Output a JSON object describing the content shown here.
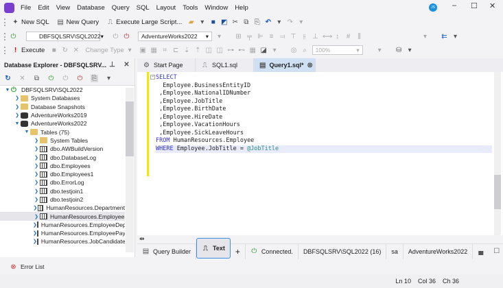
{
  "menu": [
    "File",
    "Edit",
    "View",
    "Database",
    "Query",
    "SQL",
    "Layout",
    "Tools",
    "Window",
    "Help"
  ],
  "user_initials": "JS",
  "toolbar1": {
    "new_sql": "New SQL",
    "new_query": "New Query",
    "execute_large": "Execute Large Script..."
  },
  "toolbar2": {
    "server": "DBFSQLSRV\\SQL2022",
    "database": "AdventureWorks2022"
  },
  "toolbar3": {
    "execute": "Execute",
    "change_type": "Change Type",
    "zoom": "100%"
  },
  "explorer": {
    "title": "Database Explorer - DBFSQLSRV...",
    "tree": [
      {
        "label": "DBFSQLSRV\\SQL2022",
        "level": 0,
        "icon": "server",
        "expanded": true
      },
      {
        "label": "System Databases",
        "level": 1,
        "icon": "folder"
      },
      {
        "label": "Database Snapshots",
        "level": 1,
        "icon": "folder"
      },
      {
        "label": "AdventureWorks2019",
        "level": 1,
        "icon": "database"
      },
      {
        "label": "AdventureWorks2022",
        "level": 1,
        "icon": "database",
        "expanded": true
      },
      {
        "label": "Tables (75)",
        "level": 2,
        "icon": "folder-open",
        "expanded": true
      },
      {
        "label": "System Tables",
        "level": 3,
        "icon": "folder"
      },
      {
        "label": "dbo.AWBuildVersion",
        "level": 3,
        "icon": "table"
      },
      {
        "label": "dbo.DatabaseLog",
        "level": 3,
        "icon": "table"
      },
      {
        "label": "dbo.Employees",
        "level": 3,
        "icon": "table"
      },
      {
        "label": "dbo.Employees1",
        "level": 3,
        "icon": "table"
      },
      {
        "label": "dbo.ErrorLog",
        "level": 3,
        "icon": "table"
      },
      {
        "label": "dbo.testjoin1",
        "level": 3,
        "icon": "table"
      },
      {
        "label": "dbo.testjoin2",
        "level": 3,
        "icon": "table"
      },
      {
        "label": "HumanResources.Department",
        "level": 3,
        "icon": "table"
      },
      {
        "label": "HumanResources.Employee",
        "level": 3,
        "icon": "table",
        "selected": true
      },
      {
        "label": "HumanResources.EmployeeDepartmentHistory",
        "level": 3,
        "icon": "table"
      },
      {
        "label": "HumanResources.EmployeePayHistory",
        "level": 3,
        "icon": "table"
      },
      {
        "label": "HumanResources.JobCandidate",
        "level": 3,
        "icon": "table"
      }
    ]
  },
  "tabs": [
    {
      "label": "Start Page"
    },
    {
      "label": "SQL1.sql"
    },
    {
      "label": "Query1.sql*",
      "active": true
    }
  ],
  "code": {
    "select": "SELECT",
    "cols": [
      "  Employee.BusinessEntityID",
      " ,Employee.NationalIDNumber",
      " ,Employee.JobTitle",
      " ,Employee.BirthDate",
      " ,Employee.HireDate",
      " ,Employee.VacationHours",
      " ,Employee.SickLeaveHours"
    ],
    "from_kw": "FROM",
    "from_rest": " HumanResources.Employee",
    "where_kw": "WHERE",
    "where_rest": " Employee.JobTitle = ",
    "param": "@JobTitle"
  },
  "bottom": {
    "query_builder": "Query Builder",
    "text": "Text",
    "add": "+",
    "connected": "Connected.",
    "server": "DBFSQLSRV\\SQL2022 (16)",
    "user": "sa",
    "database": "AdventureWorks2022"
  },
  "error_list": "Error List",
  "status": {
    "ln": "Ln 10",
    "col": "Col 36",
    "ch": "Ch 36"
  }
}
